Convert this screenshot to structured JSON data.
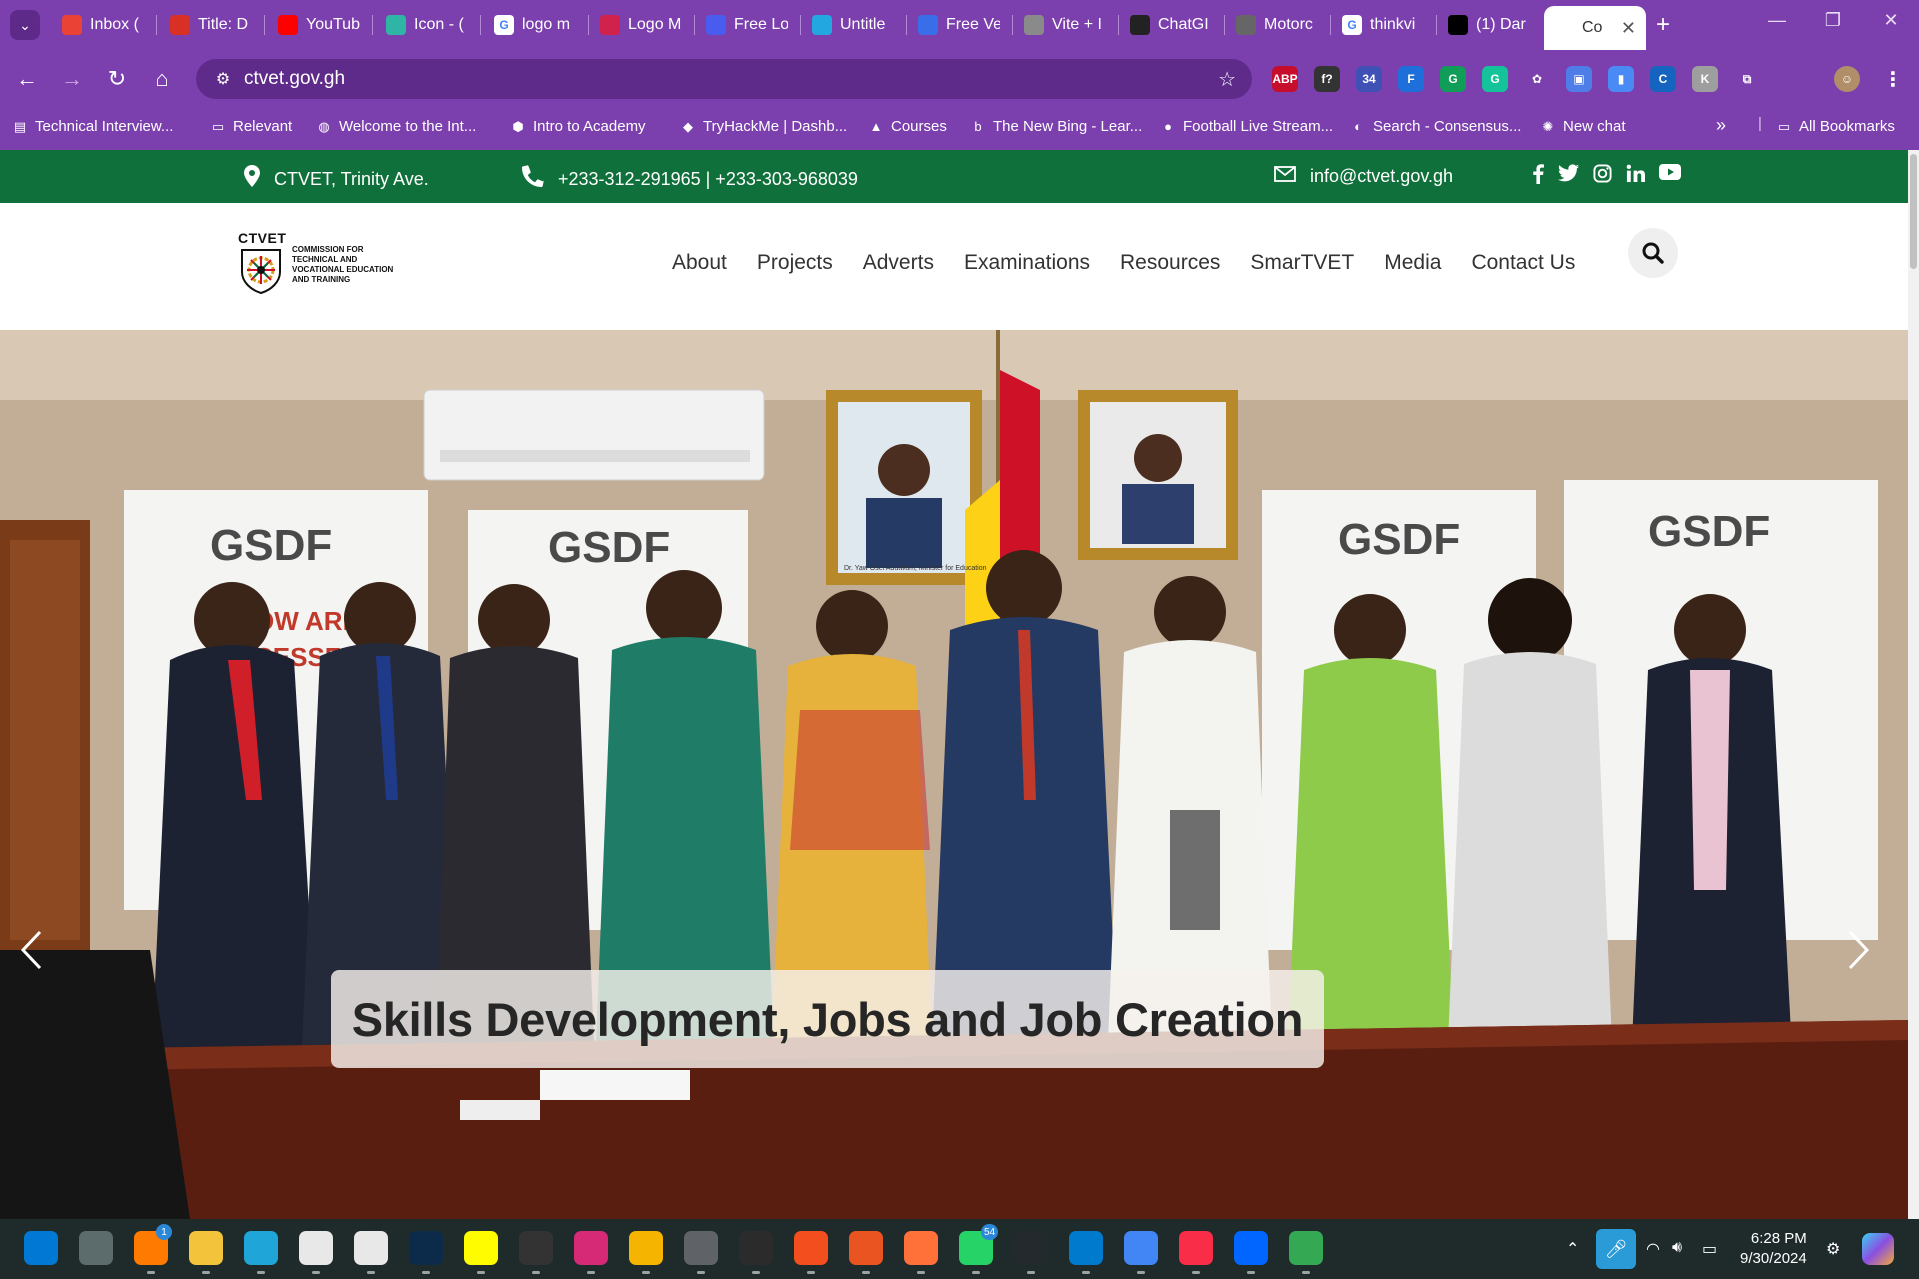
{
  "browser": {
    "tabs": [
      {
        "title": "Inbox (",
        "icon": "gmail-icon",
        "color": "#ea4335"
      },
      {
        "title": "Title: D",
        "icon": "news-icon",
        "color": "#d93025"
      },
      {
        "title": "YouTub",
        "icon": "youtube-icon",
        "color": "#ff0000"
      },
      {
        "title": "Icon - (",
        "icon": "bolt-icon",
        "color": "#2fb5a6"
      },
      {
        "title": "logo m",
        "icon": "google-icon",
        "color": "#ffffff"
      },
      {
        "title": "Logo M",
        "icon": "pen-icon",
        "color": "#d0224a"
      },
      {
        "title": "Free Lo",
        "icon": "bracket-icon",
        "color": "#4a5cf0"
      },
      {
        "title": "Untitle",
        "icon": "canva-icon",
        "color": "#22a7e0"
      },
      {
        "title": "Free Ve",
        "icon": "form-icon",
        "color": "#3a6ee8"
      },
      {
        "title": "Vite + I",
        "icon": "globe-icon",
        "color": "#8a8a8a"
      },
      {
        "title": "ChatGI",
        "icon": "openai-icon",
        "color": "#222222"
      },
      {
        "title": "Motorc",
        "icon": "image-icon",
        "color": "#666666"
      },
      {
        "title": "thinkvi",
        "icon": "google-icon",
        "color": "#ffffff"
      },
      {
        "title": "(1) Dar",
        "icon": "x-icon",
        "color": "#000000"
      },
      {
        "title": "Co",
        "icon": "ctvet-icon",
        "color": "#ffffff",
        "active": true
      }
    ],
    "url": "ctvet.gov.gh",
    "bookmarks": [
      {
        "label": "Technical Interview...",
        "icon": "bookmark-icon"
      },
      {
        "label": "Relevant",
        "icon": "folder-icon"
      },
      {
        "label": "Welcome to the Int...",
        "icon": "globe-icon"
      },
      {
        "label": "Intro to Academy",
        "icon": "cube-icon"
      },
      {
        "label": "TryHackMe | Dashb...",
        "icon": "thm-icon"
      },
      {
        "label": "Courses",
        "icon": "rocket-icon"
      },
      {
        "label": "The New Bing - Lear...",
        "icon": "bing-icon"
      },
      {
        "label": "Football Live Stream...",
        "icon": "ball-icon"
      },
      {
        "label": "Search - Consensus...",
        "icon": "consensus-icon"
      },
      {
        "label": "New chat",
        "icon": "openai-icon"
      }
    ],
    "all_bookmarks_label": "All Bookmarks",
    "extensions": [
      {
        "label": "ABP",
        "color": "#c70d2c"
      },
      {
        "label": "f?",
        "color": "#333333"
      },
      {
        "label": "34",
        "color": "#3f51b5"
      },
      {
        "label": "F",
        "color": "#1e6fd9"
      },
      {
        "label": "G",
        "color": "#0f9d58"
      },
      {
        "label": "G",
        "color": "#15c39a"
      },
      {
        "label": "✿",
        "color": "#7c3fae"
      },
      {
        "label": "▣",
        "color": "#4f7de8"
      },
      {
        "label": "▮",
        "color": "#4a8af4"
      },
      {
        "label": "C",
        "color": "#1565c0"
      },
      {
        "label": "K",
        "color": "#9e9e9e"
      },
      {
        "label": "⧉",
        "color": "#7c3fae"
      }
    ]
  },
  "site": {
    "topbar": {
      "address": "CTVET, Trinity Ave.",
      "phone": "+233-312-291965 | +233-303-968039",
      "email": "info@ctvet.gov.gh",
      "social": [
        "f",
        "t",
        "ig",
        "in",
        "yt"
      ]
    },
    "logo": {
      "wordmark": "CTVET",
      "org_name": "COMMISSION FOR TECHNICAL AND VOCATIONAL EDUCATION AND TRAINING"
    },
    "nav": [
      "About",
      "Projects",
      "Adverts",
      "Examinations",
      "Resources",
      "SmarTVET",
      "Media",
      "Contact Us"
    ],
    "hero": {
      "caption": "Skills Development, Jobs and Job Creation",
      "banner_text": "GSDF",
      "banner_partial_text": [
        "OW ARE",
        "CESSFUL"
      ],
      "portrait_caption": "Dr. Yaw Osei Adutwum, Minister for Education"
    }
  },
  "taskbar": {
    "apps": [
      {
        "name": "start-icon",
        "color": "#0078d4"
      },
      {
        "name": "task-view-icon",
        "color": "#5c6b6c"
      },
      {
        "name": "chrome-app-icon",
        "color": "#ff7a00",
        "badge": "1"
      },
      {
        "name": "file-explorer-icon",
        "color": "#f3c33c"
      },
      {
        "name": "edge-icon",
        "color": "#1fa5d8"
      },
      {
        "name": "store-icon",
        "color": "#e8e8e8"
      },
      {
        "name": "snipping-icon",
        "color": "#e8e8e8"
      },
      {
        "name": "photoshop-icon",
        "color": "#0c2a4a"
      },
      {
        "name": "snapchat-icon",
        "color": "#fffc00"
      },
      {
        "name": "terminal-icon",
        "color": "#333333"
      },
      {
        "name": "instagram-icon",
        "color": "#d62976"
      },
      {
        "name": "photos-icon",
        "color": "#f4b400"
      },
      {
        "name": "chrome-profile-icon",
        "color": "#5f6368"
      },
      {
        "name": "davinci-icon",
        "color": "#2b2b2b"
      },
      {
        "name": "figma-icon",
        "color": "#f24e1e"
      },
      {
        "name": "ubuntu-icon",
        "color": "#e95420"
      },
      {
        "name": "firefox-icon",
        "color": "#ff7139"
      },
      {
        "name": "whatsapp-icon",
        "color": "#25d366",
        "badge": "54"
      },
      {
        "name": "github-icon",
        "color": "#24292e"
      },
      {
        "name": "vscode-icon",
        "color": "#007acc"
      },
      {
        "name": "chrome-icon",
        "color": "#4285f4"
      },
      {
        "name": "music-icon",
        "color": "#fa2d48"
      },
      {
        "name": "powerautomate-icon",
        "color": "#0066ff"
      },
      {
        "name": "chrome-alt-icon",
        "color": "#34a853"
      }
    ],
    "time": "6:28 PM",
    "date": "9/30/2024"
  },
  "colors": {
    "chrome_purple": "#7c3fae",
    "site_green": "#10703b",
    "ghana_red": "#ce1126",
    "ghana_gold": "#fcd116",
    "ghana_green": "#006b3f"
  }
}
